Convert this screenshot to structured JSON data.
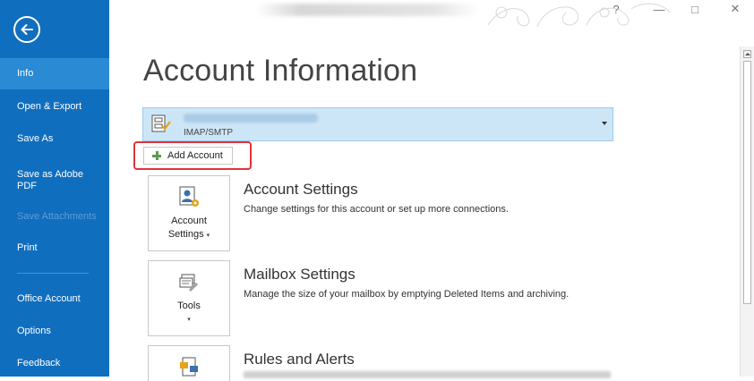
{
  "sidebar": {
    "items": [
      {
        "label": "Info",
        "state": "selected"
      },
      {
        "label": "Open & Export",
        "state": "normal"
      },
      {
        "label": "Save As",
        "state": "normal"
      },
      {
        "label": "Save as Adobe PDF",
        "state": "normal"
      },
      {
        "label": "Save Attachments",
        "state": "disabled"
      },
      {
        "label": "Print",
        "state": "normal"
      },
      {
        "label": "Office Account",
        "state": "normal"
      },
      {
        "label": "Options",
        "state": "normal"
      },
      {
        "label": "Feedback",
        "state": "normal"
      }
    ],
    "back_icon": "back-arrow-circle-icon",
    "colors": {
      "background": "#106ebe",
      "selected": "#2a8ad4",
      "disabled_text": "#5d9bd6"
    }
  },
  "titlebar": {
    "help": "?",
    "minimize": "—",
    "restore": "□",
    "close": "✕"
  },
  "main": {
    "title": "Account Information",
    "account": {
      "type": "IMAP/SMTP"
    },
    "add_account": "Add Account",
    "sections": [
      {
        "tile_label_line1": "Account",
        "tile_label_line2": "Settings",
        "title": "Account Settings",
        "description": "Change settings for this account or set up more connections."
      },
      {
        "tile_label_line1": "Tools",
        "title": "Mailbox Settings",
        "description": "Manage the size of your mailbox by emptying Deleted Items and archiving."
      },
      {
        "title": "Rules and Alerts"
      }
    ]
  },
  "colors": {
    "highlight": "#e1333b",
    "account_bg": "#cde6f7"
  }
}
